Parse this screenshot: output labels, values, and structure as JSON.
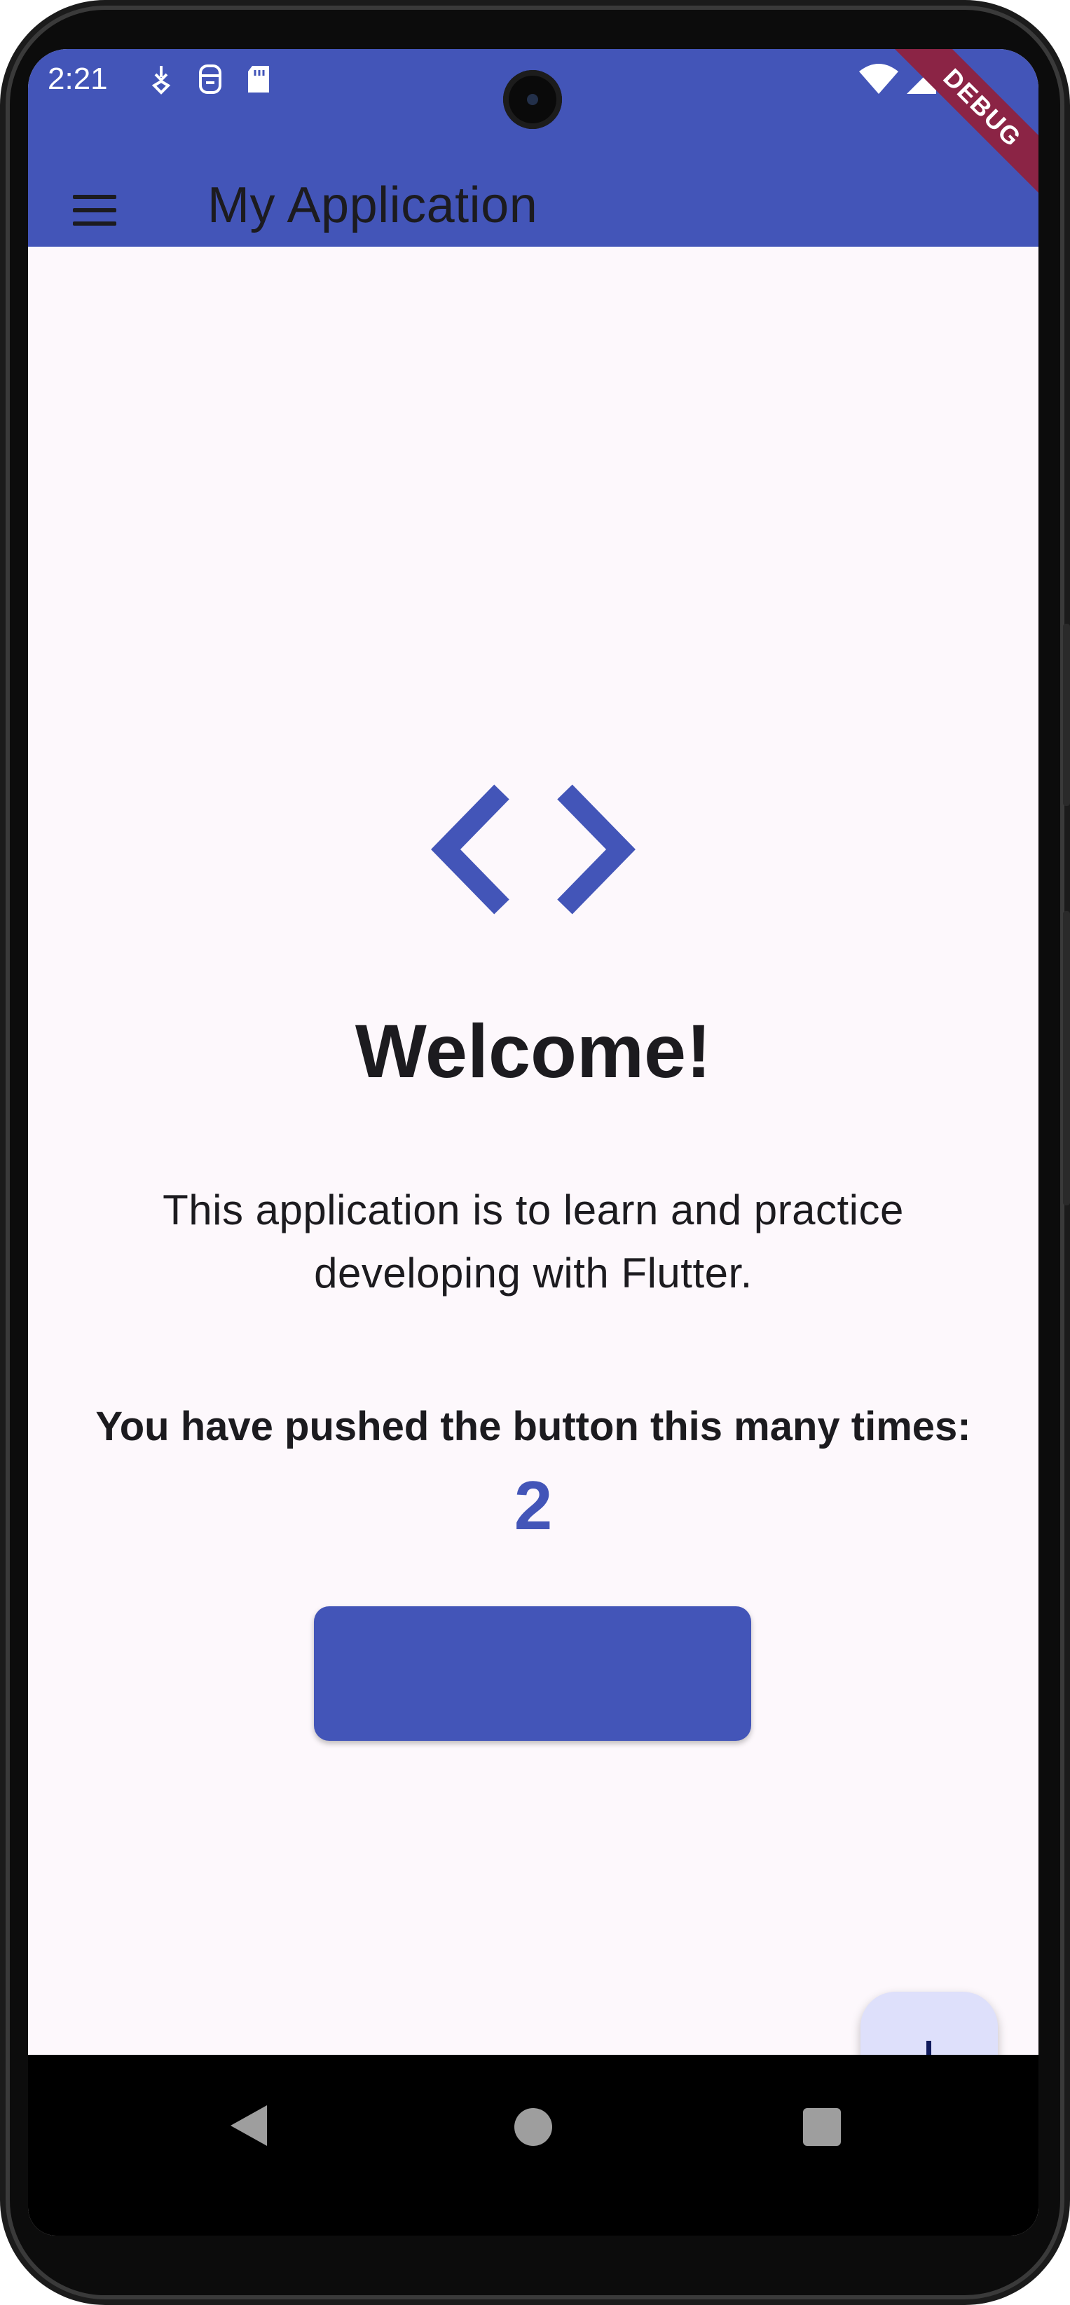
{
  "status_bar": {
    "time": "2:21",
    "icons": [
      "notification-icon",
      "sim-icon",
      "sd-card-icon",
      "wifi-icon",
      "signal-icon",
      "battery-icon"
    ]
  },
  "app_bar": {
    "title": "My Application",
    "menu_icon": "menu-icon",
    "debug_banner": "DEBUG",
    "color": "#4355b8"
  },
  "main": {
    "icon": "code-icon",
    "heading": "Welcome!",
    "description": "This application is to learn and practice developing with Flutter.",
    "counter_label": "You have pushed the button this many times:",
    "counter_value": "2",
    "button_label": ""
  },
  "fab": {
    "icon": "plus-icon",
    "color": "#dee0fb"
  },
  "nav_bar": {
    "back_icon": "back-triangle-icon",
    "home_icon": "home-circle-icon",
    "recent_icon": "recent-square-icon"
  }
}
